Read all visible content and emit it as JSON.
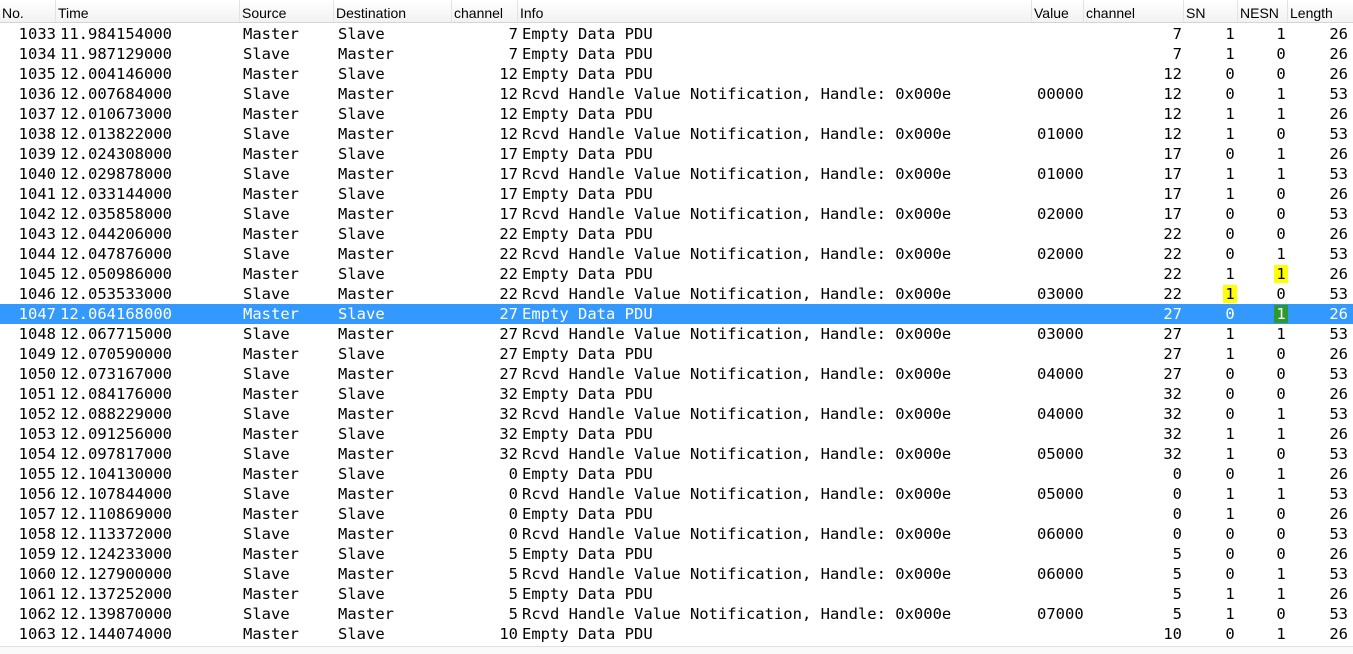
{
  "columns": [
    "No.",
    "Time",
    "Source",
    "Destination",
    "channel",
    "Info",
    "Value",
    "channel",
    "SN",
    "NESN",
    "Length"
  ],
  "colors": {
    "selection": "#3399ff",
    "highlight_yellow": "#ffff00",
    "highlight_green": "#2c9a2c"
  },
  "packets": [
    {
      "no": "1033",
      "time": "11.984154000",
      "src": "Master",
      "dst": "Slave",
      "ch": "7",
      "info": "Empty Data PDU",
      "value": "",
      "ch2": "7",
      "sn": "1",
      "nesn": "1",
      "len": "26"
    },
    {
      "no": "1034",
      "time": "11.987129000",
      "src": "Slave",
      "dst": "Master",
      "ch": "7",
      "info": "Empty Data PDU",
      "value": "",
      "ch2": "7",
      "sn": "1",
      "nesn": "0",
      "len": "26"
    },
    {
      "no": "1035",
      "time": "12.004146000",
      "src": "Master",
      "dst": "Slave",
      "ch": "12",
      "info": "Empty Data PDU",
      "value": "",
      "ch2": "12",
      "sn": "0",
      "nesn": "0",
      "len": "26"
    },
    {
      "no": "1036",
      "time": "12.007684000",
      "src": "Slave",
      "dst": "Master",
      "ch": "12",
      "info": "Rcvd Handle Value Notification, Handle: 0x000e",
      "value": "00000",
      "ch2": "12",
      "sn": "0",
      "nesn": "1",
      "len": "53"
    },
    {
      "no": "1037",
      "time": "12.010673000",
      "src": "Master",
      "dst": "Slave",
      "ch": "12",
      "info": "Empty Data PDU",
      "value": "",
      "ch2": "12",
      "sn": "1",
      "nesn": "1",
      "len": "26"
    },
    {
      "no": "1038",
      "time": "12.013822000",
      "src": "Slave",
      "dst": "Master",
      "ch": "12",
      "info": "Rcvd Handle Value Notification, Handle: 0x000e",
      "value": "01000",
      "ch2": "12",
      "sn": "1",
      "nesn": "0",
      "len": "53"
    },
    {
      "no": "1039",
      "time": "12.024308000",
      "src": "Master",
      "dst": "Slave",
      "ch": "17",
      "info": "Empty Data PDU",
      "value": "",
      "ch2": "17",
      "sn": "0",
      "nesn": "1",
      "len": "26"
    },
    {
      "no": "1040",
      "time": "12.029878000",
      "src": "Slave",
      "dst": "Master",
      "ch": "17",
      "info": "Rcvd Handle Value Notification, Handle: 0x000e",
      "value": "01000",
      "ch2": "17",
      "sn": "1",
      "nesn": "1",
      "len": "53"
    },
    {
      "no": "1041",
      "time": "12.033144000",
      "src": "Master",
      "dst": "Slave",
      "ch": "17",
      "info": "Empty Data PDU",
      "value": "",
      "ch2": "17",
      "sn": "1",
      "nesn": "0",
      "len": "26"
    },
    {
      "no": "1042",
      "time": "12.035858000",
      "src": "Slave",
      "dst": "Master",
      "ch": "17",
      "info": "Rcvd Handle Value Notification, Handle: 0x000e",
      "value": "02000",
      "ch2": "17",
      "sn": "0",
      "nesn": "0",
      "len": "53"
    },
    {
      "no": "1043",
      "time": "12.044206000",
      "src": "Master",
      "dst": "Slave",
      "ch": "22",
      "info": "Empty Data PDU",
      "value": "",
      "ch2": "22",
      "sn": "0",
      "nesn": "0",
      "len": "26"
    },
    {
      "no": "1044",
      "time": "12.047876000",
      "src": "Slave",
      "dst": "Master",
      "ch": "22",
      "info": "Rcvd Handle Value Notification, Handle: 0x000e",
      "value": "02000",
      "ch2": "22",
      "sn": "0",
      "nesn": "1",
      "len": "53"
    },
    {
      "no": "1045",
      "time": "12.050986000",
      "src": "Master",
      "dst": "Slave",
      "ch": "22",
      "info": "Empty Data PDU",
      "value": "",
      "ch2": "22",
      "sn": "1",
      "nesn": "1",
      "len": "26",
      "nesn_highlight": "yellow"
    },
    {
      "no": "1046",
      "time": "12.053533000",
      "src": "Slave",
      "dst": "Master",
      "ch": "22",
      "info": "Rcvd Handle Value Notification, Handle: 0x000e",
      "value": "03000",
      "ch2": "22",
      "sn": "1",
      "nesn": "0",
      "len": "53",
      "sn_highlight": "yellow"
    },
    {
      "no": "1047",
      "time": "12.064168000",
      "src": "Master",
      "dst": "Slave",
      "ch": "27",
      "info": "Empty Data PDU",
      "value": "",
      "ch2": "27",
      "sn": "0",
      "nesn": "1",
      "len": "26",
      "selected": true,
      "nesn_highlight": "green"
    },
    {
      "no": "1048",
      "time": "12.067715000",
      "src": "Slave",
      "dst": "Master",
      "ch": "27",
      "info": "Rcvd Handle Value Notification, Handle: 0x000e",
      "value": "03000",
      "ch2": "27",
      "sn": "1",
      "nesn": "1",
      "len": "53"
    },
    {
      "no": "1049",
      "time": "12.070590000",
      "src": "Master",
      "dst": "Slave",
      "ch": "27",
      "info": "Empty Data PDU",
      "value": "",
      "ch2": "27",
      "sn": "1",
      "nesn": "0",
      "len": "26"
    },
    {
      "no": "1050",
      "time": "12.073167000",
      "src": "Slave",
      "dst": "Master",
      "ch": "27",
      "info": "Rcvd Handle Value Notification, Handle: 0x000e",
      "value": "04000",
      "ch2": "27",
      "sn": "0",
      "nesn": "0",
      "len": "53"
    },
    {
      "no": "1051",
      "time": "12.084176000",
      "src": "Master",
      "dst": "Slave",
      "ch": "32",
      "info": "Empty Data PDU",
      "value": "",
      "ch2": "32",
      "sn": "0",
      "nesn": "0",
      "len": "26"
    },
    {
      "no": "1052",
      "time": "12.088229000",
      "src": "Slave",
      "dst": "Master",
      "ch": "32",
      "info": "Rcvd Handle Value Notification, Handle: 0x000e",
      "value": "04000",
      "ch2": "32",
      "sn": "0",
      "nesn": "1",
      "len": "53"
    },
    {
      "no": "1053",
      "time": "12.091256000",
      "src": "Master",
      "dst": "Slave",
      "ch": "32",
      "info": "Empty Data PDU",
      "value": "",
      "ch2": "32",
      "sn": "1",
      "nesn": "1",
      "len": "26"
    },
    {
      "no": "1054",
      "time": "12.097817000",
      "src": "Slave",
      "dst": "Master",
      "ch": "32",
      "info": "Rcvd Handle Value Notification, Handle: 0x000e",
      "value": "05000",
      "ch2": "32",
      "sn": "1",
      "nesn": "0",
      "len": "53"
    },
    {
      "no": "1055",
      "time": "12.104130000",
      "src": "Master",
      "dst": "Slave",
      "ch": "0",
      "info": "Empty Data PDU",
      "value": "",
      "ch2": "0",
      "sn": "0",
      "nesn": "1",
      "len": "26"
    },
    {
      "no": "1056",
      "time": "12.107844000",
      "src": "Slave",
      "dst": "Master",
      "ch": "0",
      "info": "Rcvd Handle Value Notification, Handle: 0x000e",
      "value": "05000",
      "ch2": "0",
      "sn": "1",
      "nesn": "1",
      "len": "53"
    },
    {
      "no": "1057",
      "time": "12.110869000",
      "src": "Master",
      "dst": "Slave",
      "ch": "0",
      "info": "Empty Data PDU",
      "value": "",
      "ch2": "0",
      "sn": "1",
      "nesn": "0",
      "len": "26"
    },
    {
      "no": "1058",
      "time": "12.113372000",
      "src": "Slave",
      "dst": "Master",
      "ch": "0",
      "info": "Rcvd Handle Value Notification, Handle: 0x000e",
      "value": "06000",
      "ch2": "0",
      "sn": "0",
      "nesn": "0",
      "len": "53"
    },
    {
      "no": "1059",
      "time": "12.124233000",
      "src": "Master",
      "dst": "Slave",
      "ch": "5",
      "info": "Empty Data PDU",
      "value": "",
      "ch2": "5",
      "sn": "0",
      "nesn": "0",
      "len": "26"
    },
    {
      "no": "1060",
      "time": "12.127900000",
      "src": "Slave",
      "dst": "Master",
      "ch": "5",
      "info": "Rcvd Handle Value Notification, Handle: 0x000e",
      "value": "06000",
      "ch2": "5",
      "sn": "0",
      "nesn": "1",
      "len": "53"
    },
    {
      "no": "1061",
      "time": "12.137252000",
      "src": "Master",
      "dst": "Slave",
      "ch": "5",
      "info": "Empty Data PDU",
      "value": "",
      "ch2": "5",
      "sn": "1",
      "nesn": "1",
      "len": "26"
    },
    {
      "no": "1062",
      "time": "12.139870000",
      "src": "Slave",
      "dst": "Master",
      "ch": "5",
      "info": "Rcvd Handle Value Notification, Handle: 0x000e",
      "value": "07000",
      "ch2": "5",
      "sn": "1",
      "nesn": "0",
      "len": "53"
    },
    {
      "no": "1063",
      "time": "12.144074000",
      "src": "Master",
      "dst": "Slave",
      "ch": "10",
      "info": "Empty Data PDU",
      "value": "",
      "ch2": "10",
      "sn": "0",
      "nesn": "1",
      "len": "26"
    }
  ]
}
